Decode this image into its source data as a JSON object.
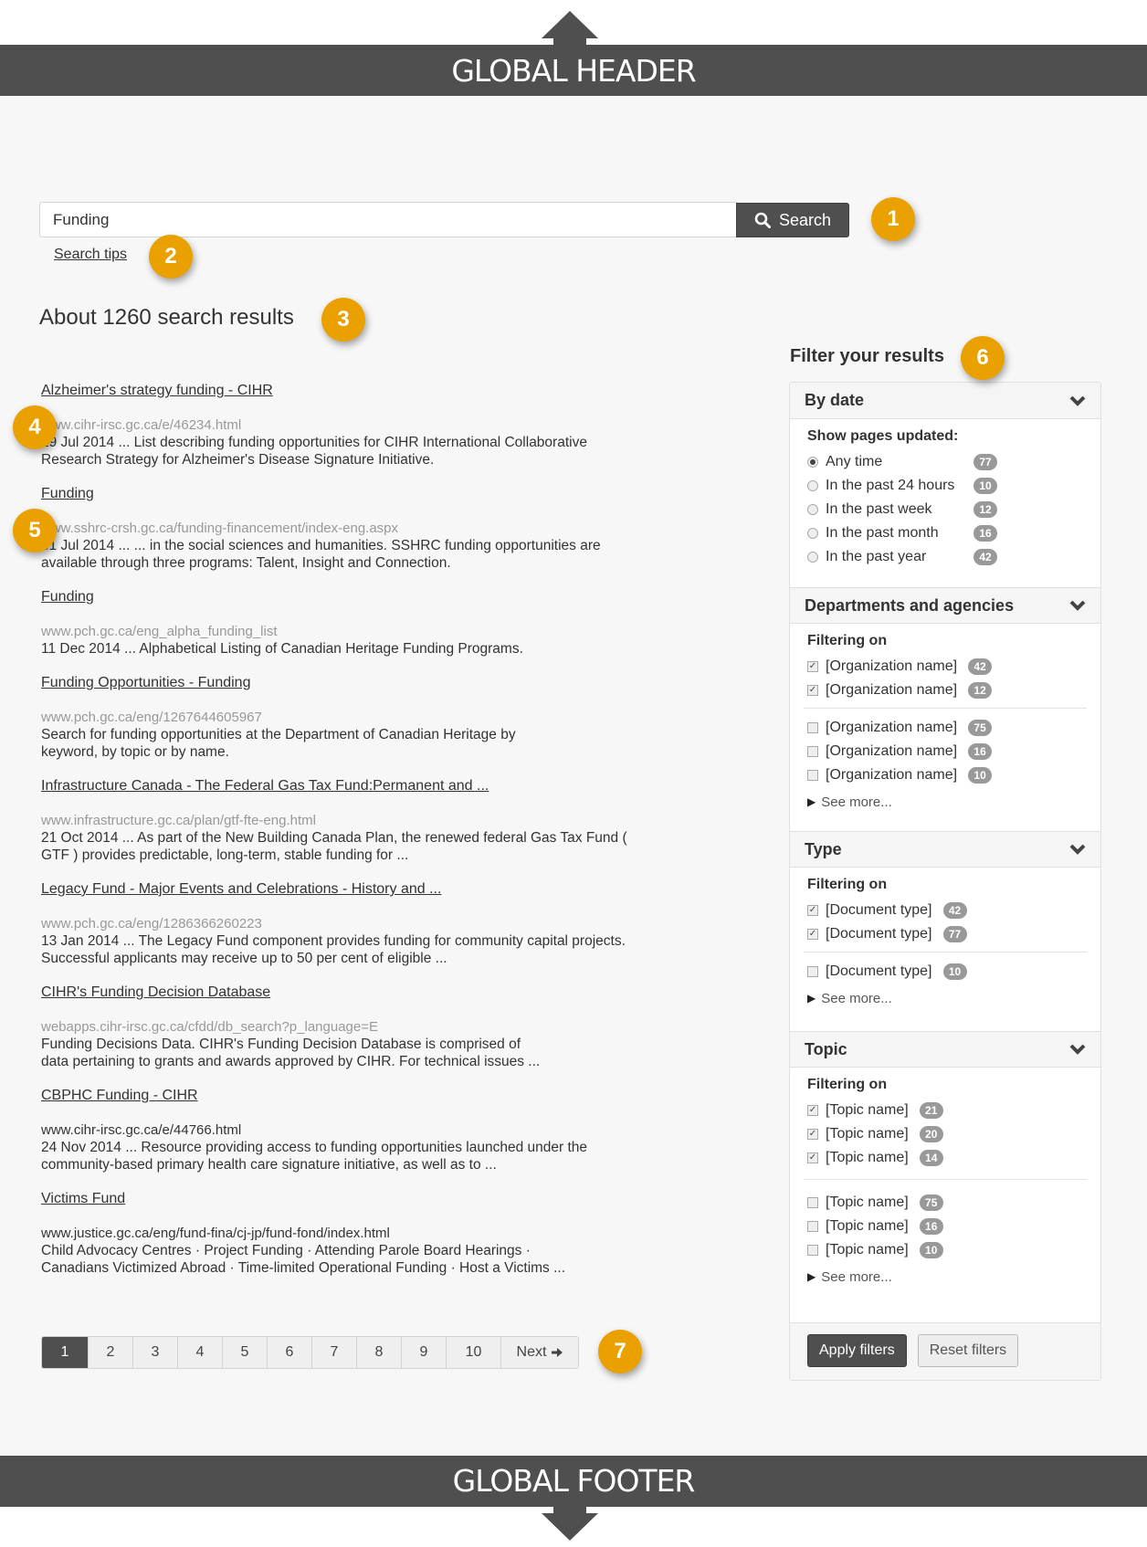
{
  "global_header": {
    "label": "GLOBAL HEADER"
  },
  "global_footer": {
    "label": "GLOBAL FOOTER"
  },
  "search": {
    "value": "Funding",
    "button_label": "Search",
    "tips_label": "Search tips"
  },
  "results_heading": "About 1260 search results",
  "markers": [
    "1",
    "2",
    "3",
    "4",
    "5",
    "6",
    "7"
  ],
  "results": [
    {
      "title": "Alzheimer's strategy funding - CIHR",
      "url": "www.cihr-irsc.gc.ca/e/46234.html",
      "desc": "29 Jul 2014 ... List describing funding opportunities for CIHR International Collaborative\nResearch Strategy for Alzheimer's Disease Signature Initiative."
    },
    {
      "title": "Funding",
      "url": "www.sshrc-crsh.gc.ca/funding-financement/index-eng.aspx",
      "desc": "31 Jul 2014 ... ... in the social sciences and humanities. SSHRC funding opportunities are\navailable through three programs: Talent, Insight and Connection."
    },
    {
      "title": "Funding",
      "url": "www.pch.gc.ca/eng_alpha_funding_list",
      "desc": "11 Dec 2014 ... Alphabetical Listing of Canadian Heritage Funding Programs."
    },
    {
      "title": "Funding Opportunities - Funding",
      "url": "www.pch.gc.ca/eng/1267644605967",
      "desc": "Search for funding opportunities at the Department of Canadian Heritage by\nkeyword, by topic or by name."
    },
    {
      "title": "Infrastructure Canada - The Federal Gas Tax Fund:Permanent and ...",
      "url": "www.infrastructure.gc.ca/plan/gtf-fte-eng.html",
      "desc": "21 Oct 2014 ... As part of the New Building Canada Plan, the renewed federal Gas Tax Fund (\nGTF ) provides predictable, long-term, stable funding for ..."
    },
    {
      "title": "Legacy Fund - Major Events and Celebrations - History and ...",
      "url": "www.pch.gc.ca/eng/1286366260223",
      "desc": "13 Jan 2014 ... The Legacy Fund component provides funding for community capital projects.\nSuccessful applicants may receive up to 50 per cent of eligible ..."
    },
    {
      "title": "CIHR's Funding Decision Database",
      "url": "webapps.cihr-irsc.gc.ca/cfdd/db_search?p_language=E",
      "desc": "Funding Decisions Data. CIHR's Funding Decision Database is comprised of\ndata pertaining to grants and awards approved by CIHR. For technical issues ..."
    },
    {
      "title": "CBPHC Funding - CIHR",
      "url": "www.cihr-irsc.gc.ca/e/44766.html",
      "desc": "24 Nov 2014 ... Resource providing access to funding opportunities launched under the\ncommunity-based primary health care signature initiative, as well as to ..."
    },
    {
      "title": "Victims Fund",
      "url": "www.justice.gc.ca/eng/fund-fina/cj-jp/fund-fond/index.html",
      "desc": "Child Advocacy Centres · Project Funding · Attending Parole Board Hearings ·\nCanadians Victimized Abroad · Time-limited Operational Funding · Host a Victims ..."
    }
  ],
  "pagination": {
    "pages": [
      "1",
      "2",
      "3",
      "4",
      "5",
      "6",
      "7",
      "8",
      "9",
      "10"
    ],
    "current": "1",
    "next_label": "Next"
  },
  "filters": {
    "heading": "Filter your results",
    "by_date": {
      "title": "By date",
      "label": "Show pages updated:",
      "options": [
        {
          "label": "Any time",
          "count": "77",
          "selected": true
        },
        {
          "label": "In the past 24 hours",
          "count": "10",
          "selected": false
        },
        {
          "label": "In the past week",
          "count": "12",
          "selected": false
        },
        {
          "label": "In the past month",
          "count": "16",
          "selected": false
        },
        {
          "label": "In the past year",
          "count": "42",
          "selected": false
        }
      ]
    },
    "departments": {
      "title": "Departments and agencies",
      "label": "Filtering on",
      "checked": [
        {
          "label": "[Organization name]",
          "count": "42"
        },
        {
          "label": "[Organization name]",
          "count": "12"
        }
      ],
      "unchecked": [
        {
          "label": "[Organization name]",
          "count": "75"
        },
        {
          "label": "[Organization name]",
          "count": "16"
        },
        {
          "label": "[Organization name]",
          "count": "10"
        }
      ],
      "see_more": "See more..."
    },
    "type": {
      "title": "Type",
      "label": "Filtering on",
      "checked": [
        {
          "label": "[Document type]",
          "count": "42"
        },
        {
          "label": "[Document type]",
          "count": "77"
        }
      ],
      "unchecked": [
        {
          "label": "[Document type]",
          "count": "10"
        }
      ],
      "see_more": "See more..."
    },
    "topic": {
      "title": "Topic",
      "label": "Filtering on",
      "checked": [
        {
          "label": "[Topic name]",
          "count": "21"
        },
        {
          "label": "[Topic name]",
          "count": "20"
        },
        {
          "label": "[Topic name]",
          "count": "14"
        }
      ],
      "unchecked": [
        {
          "label": "[Topic name]",
          "count": "75"
        },
        {
          "label": "[Topic name]",
          "count": "16"
        },
        {
          "label": "[Topic name]",
          "count": "10"
        }
      ],
      "see_more": "See more..."
    },
    "apply_label": "Apply filters",
    "reset_label": "Reset filters"
  },
  "colors": {
    "marker": "#eaa100",
    "dark_bar": "#4f4f4f",
    "badge": "#999999",
    "page_bg": "#f7f7f7"
  }
}
